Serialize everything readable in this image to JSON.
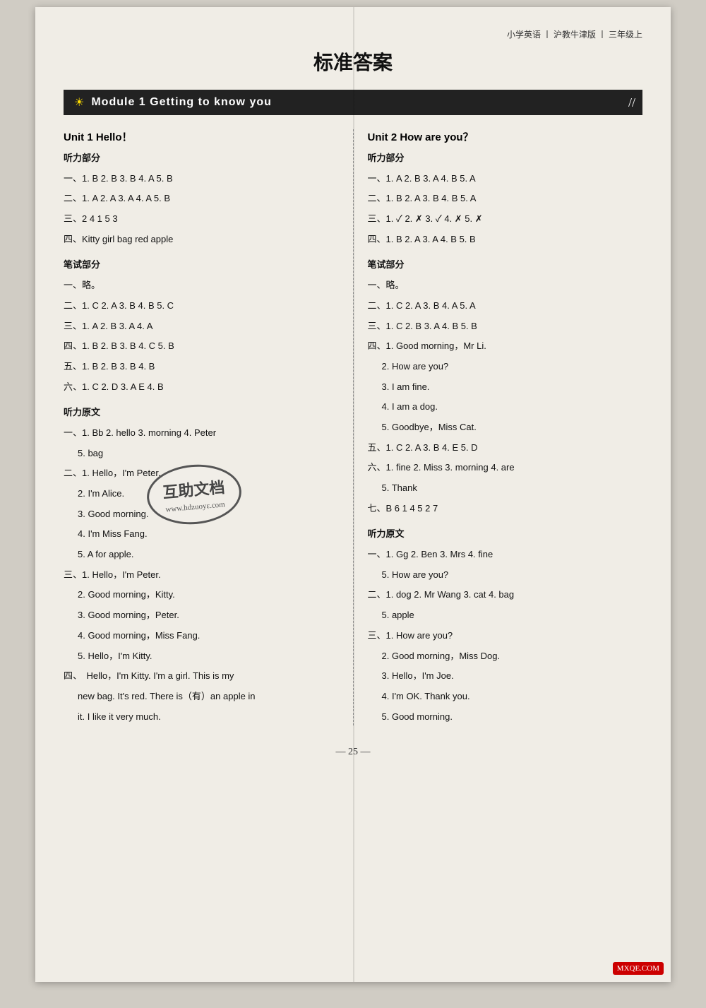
{
  "top_right": "小学英语 丨 沪教牛津版 丨 三年级上",
  "main_title": "标准答案",
  "module": {
    "title": "Module 1   Getting to know you"
  },
  "left": {
    "unit_title": "Unit 1   Hello！",
    "sections": [
      {
        "label": "听力部分",
        "lines": [
          "一、1. B   2. B   3. B   4. A   5. B",
          "二、1. A   2. A   3. A   4. A   5. B",
          "三、2   4   1   5   3",
          "四、Kitty   girl   bag   red   apple"
        ]
      },
      {
        "label": "笔试部分",
        "lines": [
          "一、略。",
          "二、1. C   2. A   3. B   4. B   5. C",
          "三、1. A   2. B   3. A   4. A",
          "四、1. B   2. B   3. B   4. C   5. B",
          "五、1. B   2. B   3. B   4. B",
          "六、1. C   2. D   3. A   E   4. B"
        ]
      },
      {
        "label": "听力原文",
        "lines": [
          "一、1. Bb   2. hello   3. morning   4. Peter",
          "    5. bag",
          "二、1. Hello，I'm Peter.",
          "    2. I'm Alice.",
          "    3. Good morning.",
          "    4. I'm Miss Fang.",
          "    5. A for apple.",
          "三、1. Hello，I'm Peter.",
          "    2. Good morning，Kitty.",
          "    3. Good morning，Peter.",
          "    4. Good morning，Miss Fang.",
          "    5. Hello，I'm Kitty.",
          "四、   Hello，I'm Kitty. I'm a girl. This is my",
          "    new bag. It's red. There is（有）an apple in",
          "    it. I like it very much."
        ]
      }
    ]
  },
  "right": {
    "unit_title": "Unit 2   How are you？",
    "sections": [
      {
        "label": "听力部分",
        "lines": [
          "一、1. A   2. B   3. A   4. B   5. A",
          "二、1. B   2. A   3. B   4. B   5. A",
          "三、1. ✓   2. ✗   3. ✓   4. ✗   5. ✗",
          "四、1. B   2. A   3. A   4. B   5. B"
        ]
      },
      {
        "label": "笔试部分",
        "lines": [
          "一、略。",
          "二、1. C   2. A   3. B   4. A   5. A",
          "三、1. C   2. B   3. A   4. B   5. B",
          "四、1. Good morning，Mr Li.",
          "    2. How are you?",
          "    3. I am fine.",
          "    4. I am a dog.",
          "    5. Goodbye，Miss Cat.",
          "五、1. C   2. A   3. B   4. E   5. D",
          "六、1. fine   2. Miss   3. morning   4. are",
          "    5. Thank",
          "七、B   6   1   4   5   2   7"
        ]
      },
      {
        "label": "听力原文",
        "lines": [
          "一、1. Gg   2. Ben   3. Mrs   4. fine",
          "    5. How are you?",
          "二、1. dog   2. Mr Wang   3. cat   4. bag",
          "    5. apple",
          "三、1. How are you?",
          "    2. Good morning，Miss Dog.",
          "    3. Hello，I'm Joe.",
          "    4. I'm OK. Thank you.",
          "    5. Good morning."
        ]
      }
    ]
  },
  "page_number": "— 25 —",
  "watermark": {
    "line1": "互助文档",
    "line2": "www.hdzuoyε.com"
  },
  "bottom_logo": "MXQE.COM"
}
